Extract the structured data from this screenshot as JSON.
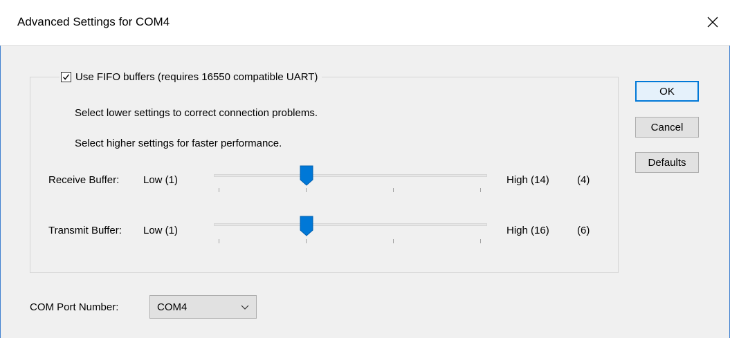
{
  "window": {
    "title": "Advanced Settings for COM4",
    "accent_color": "#0078d7"
  },
  "fifo": {
    "checkbox_label": "Use FIFO buffers (requires 16550 compatible UART)",
    "checked": true,
    "hint_lower": "Select lower settings to correct connection problems.",
    "hint_higher": "Select higher settings for faster performance."
  },
  "receive": {
    "label": "Receive Buffer:",
    "low_label": "Low (1)",
    "high_label": "High (14)",
    "value_label": "(4)",
    "value": 4
  },
  "transmit": {
    "label": "Transmit Buffer:",
    "low_label": "Low (1)",
    "high_label": "High (16)",
    "value_label": "(6)",
    "value": 6
  },
  "buttons": {
    "ok": "OK",
    "cancel": "Cancel",
    "defaults": "Defaults"
  },
  "com_port": {
    "label": "COM Port Number:",
    "selected": "COM4"
  },
  "icons": {
    "close": "close-icon",
    "check": "checkmark-icon",
    "dropdown": "chevron-down-icon",
    "slider_thumb": "slider-thumb"
  }
}
